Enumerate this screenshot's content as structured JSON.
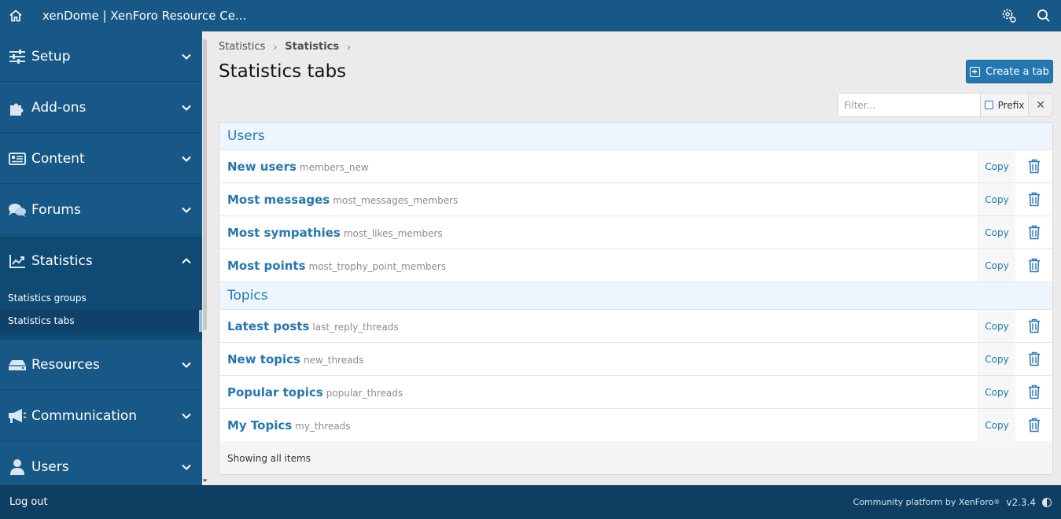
{
  "header": {
    "title": "xenDome | XenForo Resource Ce...",
    "home_icon": "home-icon",
    "settings_icon": "settings-icon",
    "search_icon": "search-icon"
  },
  "sidebar": {
    "sections": [
      {
        "label": "Setup",
        "icon": "sliders-icon"
      },
      {
        "label": "Add-ons",
        "icon": "puzzle-icon"
      },
      {
        "label": "Content",
        "icon": "content-icon"
      },
      {
        "label": "Forums",
        "icon": "comments-icon"
      },
      {
        "label": "Statistics",
        "icon": "chart-icon"
      },
      {
        "label": "Resources",
        "icon": "drive-icon"
      },
      {
        "label": "Communication",
        "icon": "megaphone-icon"
      },
      {
        "label": "Users",
        "icon": "user-icon"
      }
    ],
    "subitems": [
      {
        "label": "Statistics groups"
      },
      {
        "label": "Statistics tabs"
      }
    ]
  },
  "breadcrumb": [
    "Statistics",
    "Statistics"
  ],
  "page": {
    "title": "Statistics tabs",
    "create_label": "Create a tab"
  },
  "filter": {
    "placeholder": "Filter...",
    "prefix_label": "Prefix",
    "clear_symbol": "✕"
  },
  "groups": [
    {
      "title": "Users",
      "rows": [
        {
          "title": "New users",
          "hint": "members_new",
          "copy": "Copy"
        },
        {
          "title": "Most messages",
          "hint": "most_messages_members",
          "copy": "Copy"
        },
        {
          "title": "Most sympathies",
          "hint": "most_likes_members",
          "copy": "Copy"
        },
        {
          "title": "Most points",
          "hint": "most_trophy_point_members",
          "copy": "Copy"
        }
      ]
    },
    {
      "title": "Topics",
      "rows": [
        {
          "title": "Latest posts",
          "hint": "last_reply_threads",
          "copy": "Copy"
        },
        {
          "title": "New topics",
          "hint": "new_threads",
          "copy": "Copy"
        },
        {
          "title": "Popular topics",
          "hint": "popular_threads",
          "copy": "Copy"
        },
        {
          "title": "My Topics",
          "hint": "my_threads",
          "copy": "Copy"
        }
      ]
    }
  ],
  "list_footer": "Showing all items",
  "footer": {
    "logout": "Log out",
    "credit": "Community platform by XenForo",
    "reg": "®",
    "version": "v2.3.4"
  },
  "colors": {
    "header_bg": "#185886",
    "accent": "#2577b1",
    "footer_bg": "#0f3e63"
  }
}
